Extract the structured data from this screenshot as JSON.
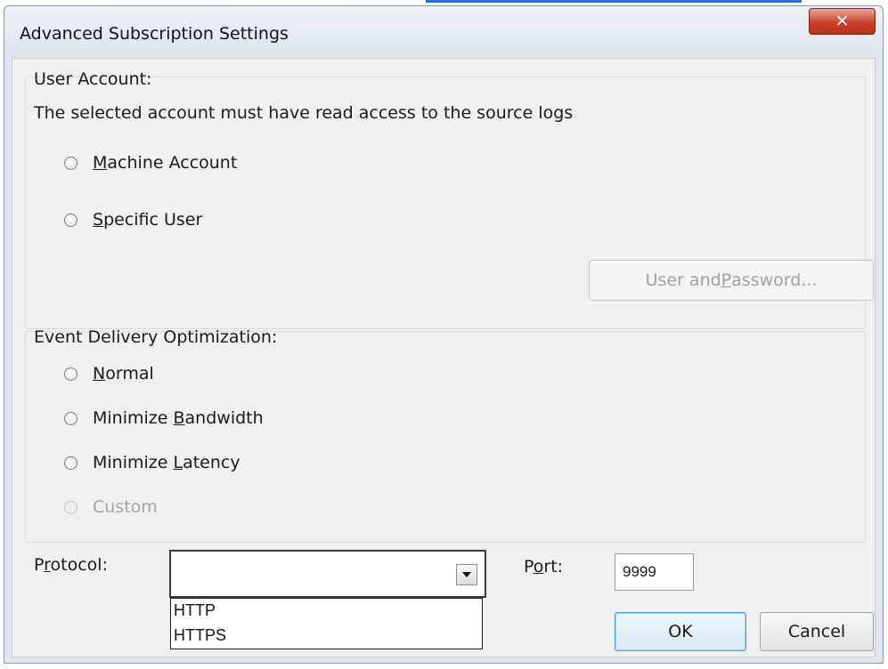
{
  "dialog": {
    "title": "Advanced Subscription Settings",
    "close_glyph": "✕"
  },
  "user_account": {
    "heading": "User Account:",
    "description": "The selected account must have read access to the source logs",
    "options": [
      {
        "label_pre": "",
        "label_key": "M",
        "label_post": "achine Account",
        "selected": false
      },
      {
        "label_pre": "",
        "label_key": "S",
        "label_post": "pecific User",
        "selected": false
      }
    ],
    "credentials_button": {
      "label_pre": "User and ",
      "label_key": "P",
      "label_post": "assword...",
      "enabled": false
    }
  },
  "event_delivery": {
    "heading": "Event Delivery Optimization:",
    "options": [
      {
        "label_pre": "",
        "label_key": "N",
        "label_post": "ormal",
        "selected": false,
        "enabled": true
      },
      {
        "label_pre": "Minimize ",
        "label_key": "B",
        "label_post": "andwidth",
        "selected": false,
        "enabled": true
      },
      {
        "label_pre": "Minimize ",
        "label_key": "L",
        "label_post": "atency",
        "selected": false,
        "enabled": true
      },
      {
        "label_pre": "Custom",
        "label_key": "",
        "label_post": "",
        "selected": false,
        "enabled": false
      }
    ]
  },
  "protocol": {
    "label_pre": "P",
    "label_key": "r",
    "label_post": "otocol:",
    "value": "",
    "options": [
      "HTTP",
      "HTTPS"
    ]
  },
  "port": {
    "label_pre": "P",
    "label_key": "o",
    "label_post": "rt:",
    "value": "9999"
  },
  "buttons": {
    "ok": "OK",
    "cancel": "Cancel"
  },
  "colors": {
    "accent_focus": "#3c9bd6",
    "close_red": "#c9412a"
  }
}
